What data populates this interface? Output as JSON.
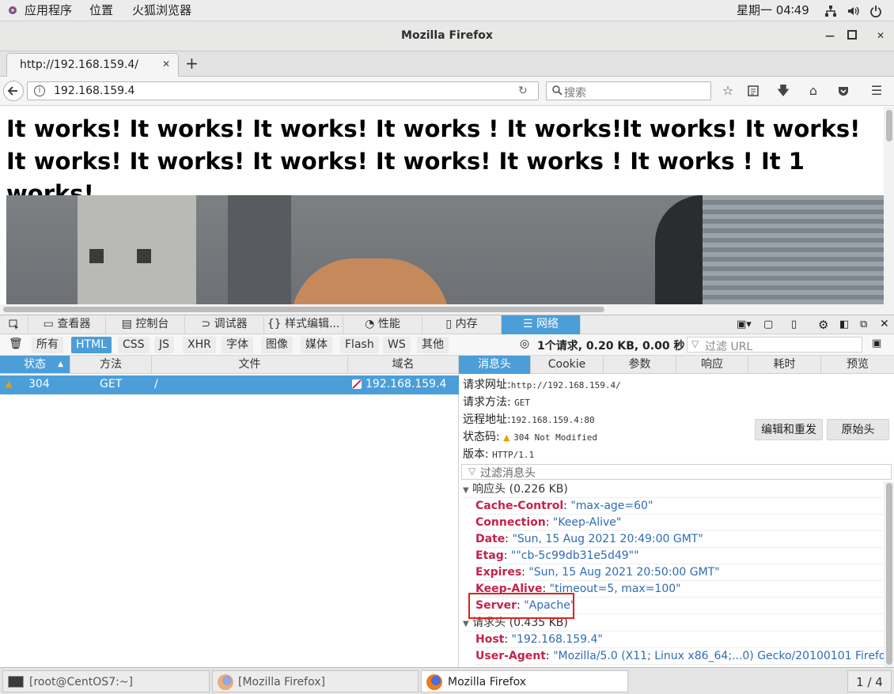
{
  "topbar": {
    "apps": "应用程序",
    "places": "位置",
    "firefox": "火狐浏览器",
    "clock": "星期一 04∶49"
  },
  "window": {
    "title": "Mozilla Firefox",
    "minimize": "—",
    "maximize": "◻",
    "close": "✕"
  },
  "tab": {
    "title": "http://192.168.159.4/",
    "close": "✕",
    "new_tab": "+"
  },
  "nav": {
    "url": "192.168.159.4",
    "search_placeholder": "搜索"
  },
  "page": {
    "heading": "It works! It works! It works! It works ! It works!It works! It works! It works! It works! It works! It works! It works ! It works ! It 1 works!"
  },
  "devtools": {
    "tabs": [
      "查看器",
      "控制台",
      "调试器",
      "样式编辑...",
      "性能",
      "内存",
      "网络"
    ],
    "filters": [
      "所有",
      "HTML",
      "CSS",
      "JS",
      "XHR",
      "字体",
      "图像",
      "媒体",
      "Flash",
      "WS",
      "其他"
    ],
    "summary": "1个请求, 0.20 KB, 0.00 秒",
    "filter_url_placeholder": "过滤 URL",
    "columns": [
      "状态",
      "方法",
      "文件",
      "域名"
    ],
    "request": {
      "status": "304",
      "method": "GET",
      "file": "/",
      "domain": "192.168.159.4"
    },
    "detail_tabs": [
      "消息头",
      "Cookie",
      "参数",
      "响应",
      "耗时",
      "预览"
    ],
    "req_url_label": "请求网址:",
    "req_url": "http://192.168.159.4/",
    "req_method_label": "请求方法:",
    "req_method": "GET",
    "remote_label": "远程地址:",
    "remote": "192.168.159.4:80",
    "status_label": "状态码:",
    "status_text": "304 Not Modified",
    "version_label": "版本:",
    "version": "HTTP/1.1",
    "edit_resend": "编辑和重发",
    "raw_headers": "原始头",
    "filter_headers_placeholder": "过滤消息头",
    "response_headers_title": "响应头 (0.226 KB)",
    "response_headers": [
      {
        "k": "Cache-Control",
        "v": "\"max-age=60\""
      },
      {
        "k": "Connection",
        "v": "\"Keep-Alive\""
      },
      {
        "k": "Date",
        "v": "\"Sun, 15 Aug 2021 20:49:00 GMT\""
      },
      {
        "k": "Etag",
        "v": "\"\"cb-5c99db31e5d49\"\""
      },
      {
        "k": "Expires",
        "v": "\"Sun, 15 Aug 2021 20:50:00 GMT\""
      },
      {
        "k": "Keep-Alive",
        "v": "\"timeout=5, max=100\""
      },
      {
        "k": "Server",
        "v": "\"Apache\""
      }
    ],
    "request_headers_title": "请求头 (0.435 KB)",
    "request_headers": [
      {
        "k": "Host",
        "v": "\"192.168.159.4\""
      },
      {
        "k": "User-Agent",
        "v": "\"Mozilla/5.0 (X11; Linux x86_64;...0) Gecko/20100101 Firefox/52.0\""
      }
    ]
  },
  "taskbar": {
    "terminal": "[root@CentOS7:~]",
    "firefox_bracket": "[Mozilla Firefox]",
    "firefox": "Mozilla Firefox",
    "workspace": "1 / 4"
  },
  "colors": {
    "accent": "#4c9ed9",
    "header_key": "#c5224b",
    "header_value": "#2f6bb5",
    "highlight": "#e02020"
  }
}
